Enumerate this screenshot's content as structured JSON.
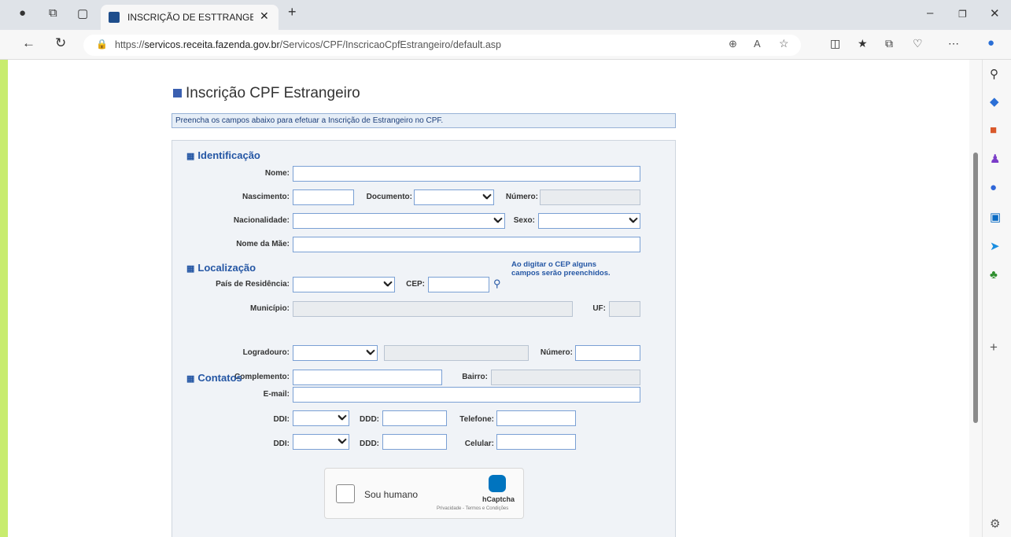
{
  "browser": {
    "tab_title": "INSCRIÇÃO DE ESTTRANGEIRO N",
    "url_prefix": "https://",
    "url_domain": "servicos.receita.fazenda.gov.br",
    "url_path": "/Servicos/CPF/InscricaoCpfEstrangeiro/default.asp"
  },
  "page": {
    "title": "Inscrição CPF Estrangeiro",
    "instruction": "Preencha os campos abaixo para efetuar a Inscrição de Estrangeiro no CPF."
  },
  "sections": {
    "identificacao": "Identificação",
    "localizacao": "Localização",
    "contatos": "Contatos"
  },
  "labels": {
    "nome": "Nome:",
    "nascimento": "Nascimento:",
    "documento": "Documento:",
    "numero": "Número:",
    "nacionalidade": "Nacionalidade:",
    "sexo": "Sexo:",
    "nome_mae": "Nome da Mãe:",
    "pais": "País de Residência:",
    "cep": "CEP:",
    "municipio": "Município:",
    "uf": "UF:",
    "logradouro": "Logradouro:",
    "numero_end": "Número:",
    "complemento": "Complemento:",
    "bairro": "Bairro:",
    "email": "E-mail:",
    "ddi1": "DDI:",
    "ddd1": "DDD:",
    "telefone": "Telefone:",
    "ddi2": "DDI:",
    "ddd2": "DDD:",
    "celular": "Celular:"
  },
  "cep_note_1": "Ao digitar o CEP alguns",
  "cep_note_2": "campos serão preenchidos.",
  "captcha": {
    "label": "Sou humano",
    "brand": "hCaptcha",
    "links": "Privacidade - Termos e Condições"
  }
}
